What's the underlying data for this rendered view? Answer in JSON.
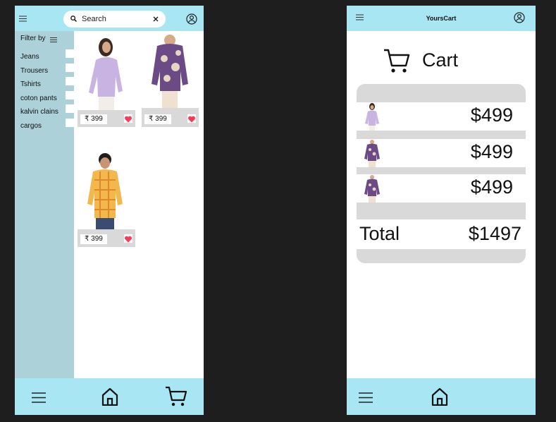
{
  "left_screen": {
    "search": {
      "placeholder": "Search",
      "search_icon": "search-icon",
      "clear_icon": "close-icon"
    },
    "menu_icon": "hamburger-icon",
    "profile_icon": "user-circle-icon",
    "sidebar": {
      "title": "Filter by",
      "title_icon": "filter-lines-icon",
      "items": [
        {
          "label": "Jeans",
          "checked": false
        },
        {
          "label": "Trousers",
          "checked": false
        },
        {
          "label": "Tshirts",
          "checked": false
        },
        {
          "label": "coton pants",
          "checked": false
        },
        {
          "label": "kalvin clains",
          "checked": false
        },
        {
          "label": "cargos",
          "checked": false
        }
      ]
    },
    "products": [
      {
        "price": "₹ 399",
        "favorite": true,
        "image": "woman-lilac-shirt"
      },
      {
        "price": "₹ 399",
        "favorite": true,
        "image": "purple-floral-shirt"
      },
      {
        "price": "₹ 399",
        "favorite": true,
        "image": "man-orange-check-shirt"
      }
    ],
    "bottom_nav": {
      "menu_icon": "hamburger-icon",
      "home_icon": "home-icon",
      "cart_icon": "cart-icon"
    }
  },
  "right_screen": {
    "brand": "YoursCart",
    "menu_icon": "hamburger-icon",
    "profile_icon": "user-circle-icon",
    "cart": {
      "title": "Cart",
      "title_icon": "cart-icon",
      "items": [
        {
          "price": "$499",
          "image": "woman-lilac-shirt"
        },
        {
          "price": "$499",
          "image": "purple-floral-shirt"
        },
        {
          "price": "$499",
          "image": "purple-floral-shirt"
        }
      ],
      "total_label": "Total",
      "total_value": "$1497"
    },
    "bottom_nav": {
      "menu_icon": "hamburger-icon",
      "home_icon": "home-icon"
    }
  },
  "colors": {
    "canvas": "#1e1e1e",
    "bar": "#a8e6f4",
    "sidebar": "#acd1d9",
    "panel": "#d9d9d9",
    "heart": "#ff3b5c"
  }
}
